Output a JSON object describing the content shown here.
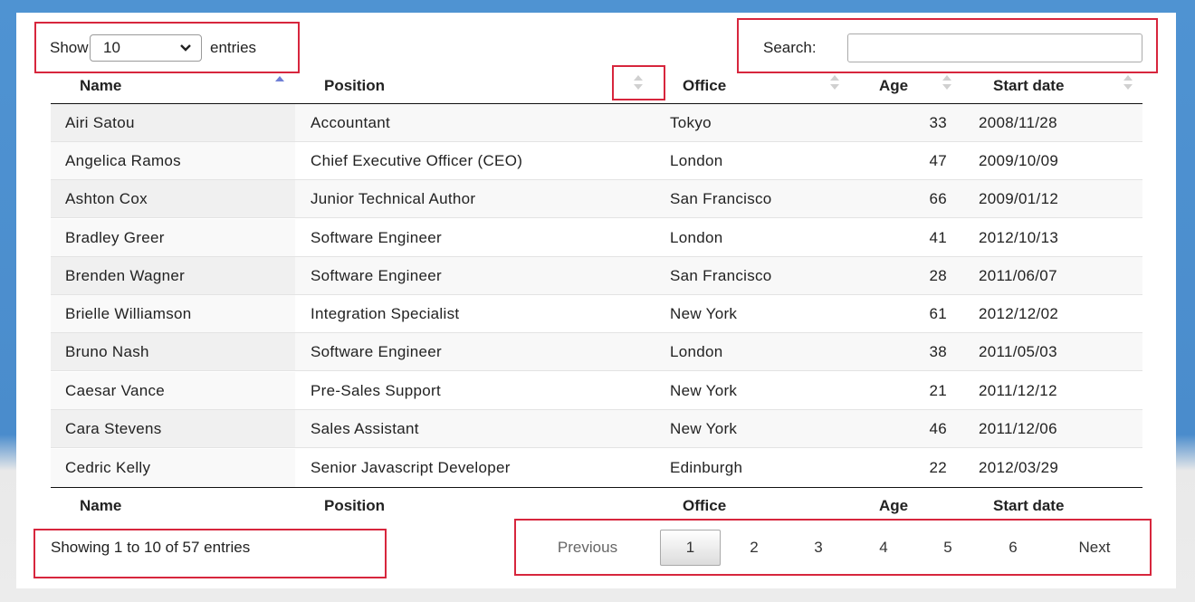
{
  "length": {
    "show_label": "Show",
    "value": "10",
    "entries_label": "entries"
  },
  "search": {
    "label": "Search:",
    "value": ""
  },
  "columns": [
    "Name",
    "Position",
    "Office",
    "Age",
    "Start date"
  ],
  "rows": [
    [
      "Airi Satou",
      "Accountant",
      "Tokyo",
      "33",
      "2008/11/28"
    ],
    [
      "Angelica Ramos",
      "Chief Executive Officer (CEO)",
      "London",
      "47",
      "2009/10/09"
    ],
    [
      "Ashton Cox",
      "Junior Technical Author",
      "San Francisco",
      "66",
      "2009/01/12"
    ],
    [
      "Bradley Greer",
      "Software Engineer",
      "London",
      "41",
      "2012/10/13"
    ],
    [
      "Brenden Wagner",
      "Software Engineer",
      "San Francisco",
      "28",
      "2011/06/07"
    ],
    [
      "Brielle Williamson",
      "Integration Specialist",
      "New York",
      "61",
      "2012/12/02"
    ],
    [
      "Bruno Nash",
      "Software Engineer",
      "London",
      "38",
      "2011/05/03"
    ],
    [
      "Caesar Vance",
      "Pre-Sales Support",
      "New York",
      "21",
      "2011/12/12"
    ],
    [
      "Cara Stevens",
      "Sales Assistant",
      "New York",
      "46",
      "2011/12/06"
    ],
    [
      "Cedric Kelly",
      "Senior Javascript Developer",
      "Edinburgh",
      "22",
      "2012/03/29"
    ]
  ],
  "info": "Showing 1 to 10 of 57 entries",
  "pagination": {
    "previous": "Previous",
    "pages": [
      "1",
      "2",
      "3",
      "4",
      "5",
      "6"
    ],
    "current": "1",
    "next": "Next"
  },
  "colors": {
    "highlight": "#d7263d",
    "sort_active": "#6f7fd6",
    "sort_inactive": "#d0d0d0"
  }
}
